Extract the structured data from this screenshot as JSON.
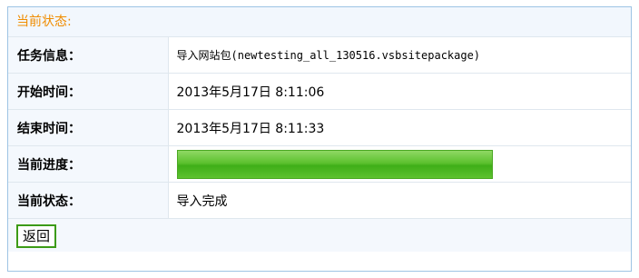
{
  "header": {
    "title": "当前状态:"
  },
  "rows": [
    {
      "label": "任务信息：",
      "value": "导入网站包(newtesting_all_130516.vsbsitepackage)"
    },
    {
      "label": "开始时间：",
      "value": "2013年5月17日 8:11:06"
    },
    {
      "label": "结束时间：",
      "value": "2013年5月17日 8:11:33"
    },
    {
      "label": "当前进度：",
      "progress": 1.0
    },
    {
      "label": "当前状态：",
      "value": "导入完成"
    }
  ],
  "footer": {
    "back_label": "返回"
  },
  "colors": {
    "header_text": "#f08c00",
    "progress_green": "#4aa823"
  }
}
